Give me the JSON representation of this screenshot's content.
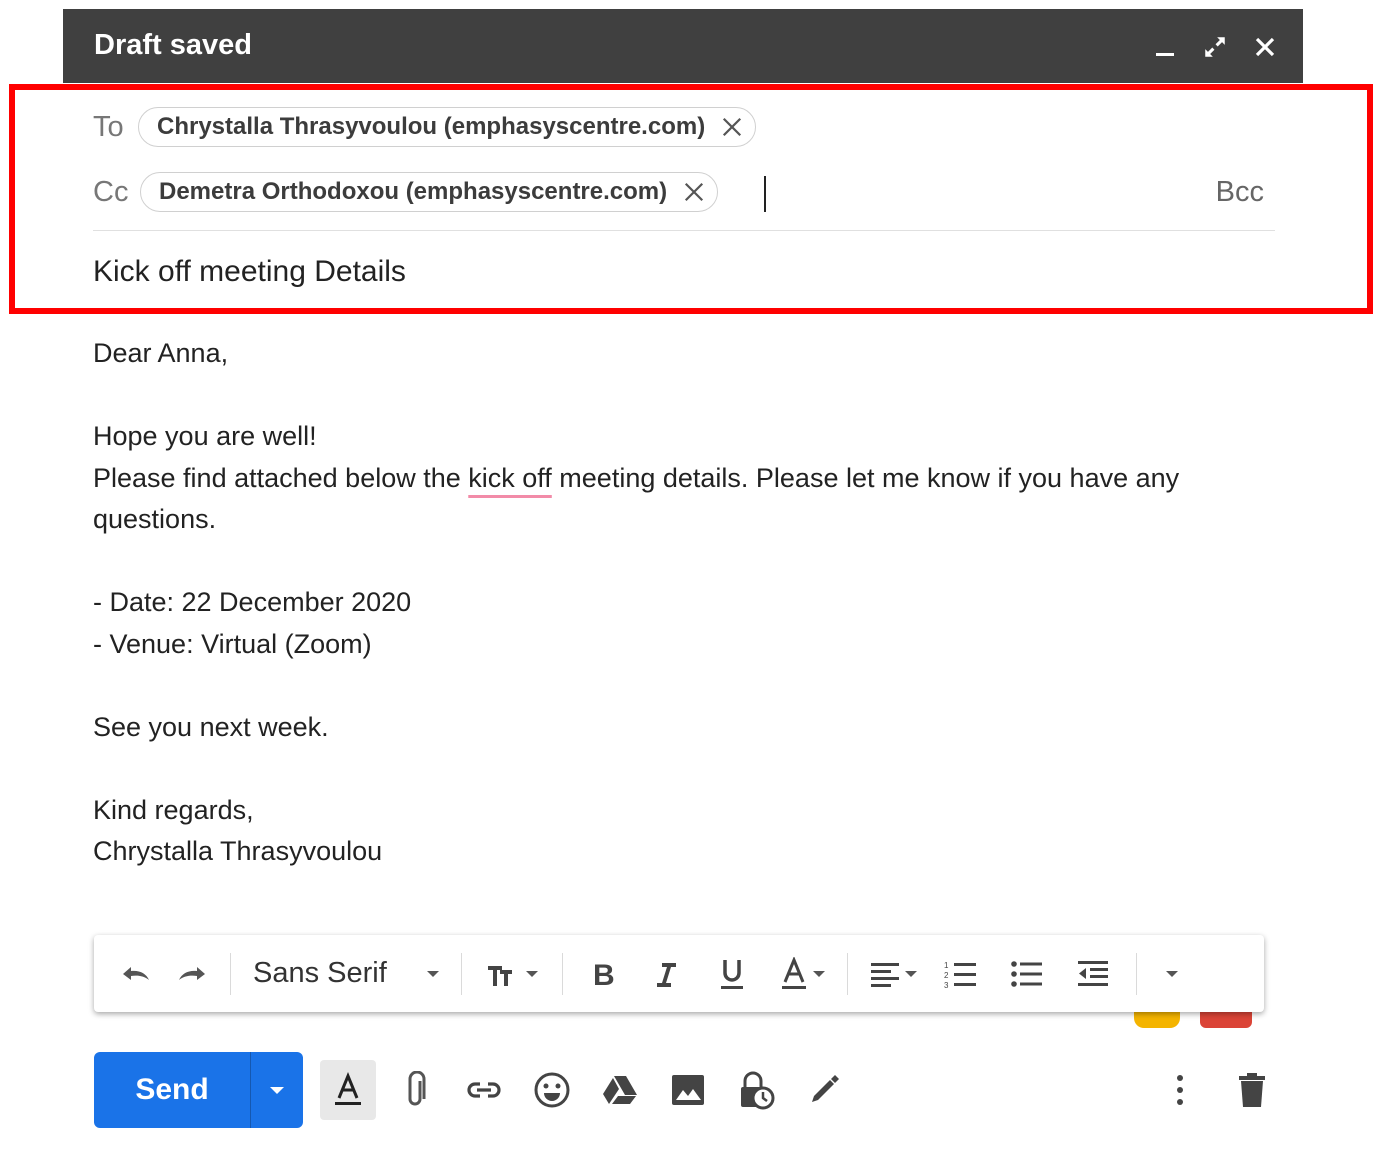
{
  "header": {
    "title": "Draft saved"
  },
  "recipients": {
    "to_label": "To",
    "to_chip": "Chrystalla Thrasyvoulou (emphasyscentre.com)",
    "cc_label": "Cc",
    "cc_chip": "Demetra Orthodoxou (emphasyscentre.com)",
    "bcc_label": "Bcc"
  },
  "subject": "Kick off meeting Details",
  "body": {
    "greeting": "Dear Anna,",
    "line1": "Hope you are well!",
    "line2_before": "Please find attached below the ",
    "line2_misspelled": "kick off",
    "line2_after": " meeting details. Please let me know if you have any questions.",
    "date_line": "- Date: 22 December 2020",
    "venue_line": "- Venue: Virtual (Zoom)",
    "closing1": "See you next week.",
    "signoff": "Kind regards,",
    "signature": "Chrystalla Thrasyvoulou"
  },
  "formatting_toolbar": {
    "font": "Sans Serif"
  },
  "send": {
    "label": "Send"
  },
  "colors": {
    "header_bg": "#404040",
    "send_bg": "#1a73e8",
    "highlight": "#ff0000",
    "spellcheck": "#f28ba8"
  }
}
